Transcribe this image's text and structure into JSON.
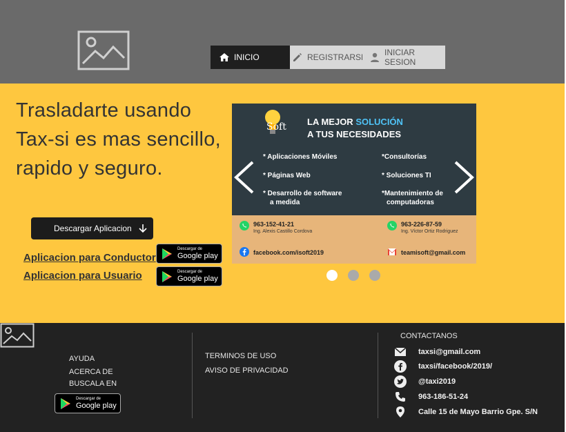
{
  "nav": {
    "inicio": "INICIO",
    "registrarse": "REGISTRARSE",
    "iniciar_sesion": "INICIAR SESION"
  },
  "hero": {
    "headline": "Trasladarte usando Tax-si es mas sencillo, rapido y seguro.",
    "download_button": "Descargar Aplicacion",
    "link_conductor": "Aplicacion para Conductor",
    "link_usuario": "Aplicacion para Usuario"
  },
  "google_play": {
    "small": "Descargar de",
    "big": "Google play"
  },
  "carousel": {
    "brand": "Soft",
    "title_part1": "LA MEJOR ",
    "title_highlight": "SOLUCIÓN",
    "title_part2": "A TUS NECESIDADES",
    "services_left": [
      "* Aplicaciones Móviles",
      "* Páginas Web",
      "* Desarrollo de software",
      "a medida"
    ],
    "services_right": [
      "*Consultorías",
      "* Soluciones TI",
      "*Mantenimiento de",
      "computadoras"
    ],
    "contact1_num": "963-152-41-21",
    "contact1_name": "Ing. Alexis Castillo Cordova",
    "contact2_num": "963-226-87-59",
    "contact2_name": "Ing. Víctor Ortiz Rodriguez",
    "facebook": "facebook.com/isoft2019",
    "email": "teamisoft@gmail.com",
    "active_slide": 1,
    "slide_count": 3
  },
  "footer": {
    "ayuda": "AYUDA",
    "acerca": "ACERCA DE",
    "buscala": "BUSCALA EN",
    "terminos": "TERMINOS DE USO",
    "privacidad": "AVISO DE PRIVACIDAD",
    "contact_title": "CONTACTANOS",
    "email": "taxsi@gmail.com",
    "facebook": "taxsi/facebook/2019/",
    "twitter": "@taxi2019",
    "phone": "963-186-51-24",
    "address": "Calle 15 de Mayo Barrio Gpe. S/N"
  },
  "colors": {
    "header_bg": "#6a6a6a",
    "hero_bg": "#fec73f",
    "footer_bg": "#222222",
    "nav_active": "#1f1f1f"
  }
}
